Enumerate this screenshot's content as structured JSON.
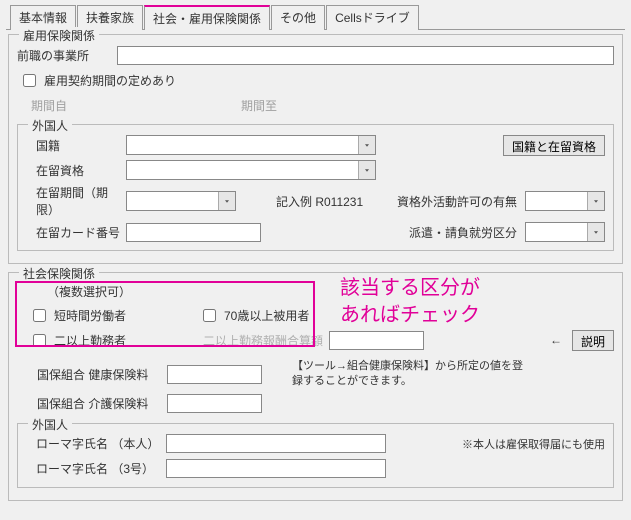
{
  "tabs": [
    "基本情報",
    "扶養家族",
    "社会・雇用保険関係",
    "その他",
    "Cellsドライブ"
  ],
  "employment": {
    "legend": "雇用保険関係",
    "prev_office_label": "前職の事業所",
    "contract_term_label": "雇用契約期間の定めあり",
    "period_from_label": "期間自",
    "period_to_label": "期間至",
    "foreigner": {
      "legend": "外国人",
      "nationality_label": "国籍",
      "nat_button": "国籍と在留資格",
      "residence_status_label": "在留資格",
      "residence_period_label": "在留期間（期限）",
      "example_label": "記入例  R011231",
      "activity_permit_label": "資格外活動許可の有無",
      "card_no_label": "在留カード番号",
      "dispatch_label": "派遣・請負就労区分"
    }
  },
  "social": {
    "legend": "社会保険関係",
    "multi_select_label": "（複数選択可）",
    "short_time_label": "短時間労働者",
    "over70_label": "70歳以上被用者",
    "dual_worker_label": "二以上勤務者",
    "dual_pay_label": "二以上勤務報酬合算額",
    "arrow": "←",
    "explain_btn": "説明",
    "kokuho_health_label": "国保組合  健康保険料",
    "kokuho_care_label": "国保組合  介護保険料",
    "kokuho_note": "【ツール→組合健康保険料】から所定の値を登録することができます。",
    "foreigner2": {
      "legend": "外国人",
      "roman_self_label": "ローマ字氏名 （本人）",
      "roman_3go_label": "ローマ字氏名 （3号）",
      "note": "※本人は雇保取得届にも使用"
    }
  },
  "annotation": "該当する区分が\nあればチェック"
}
